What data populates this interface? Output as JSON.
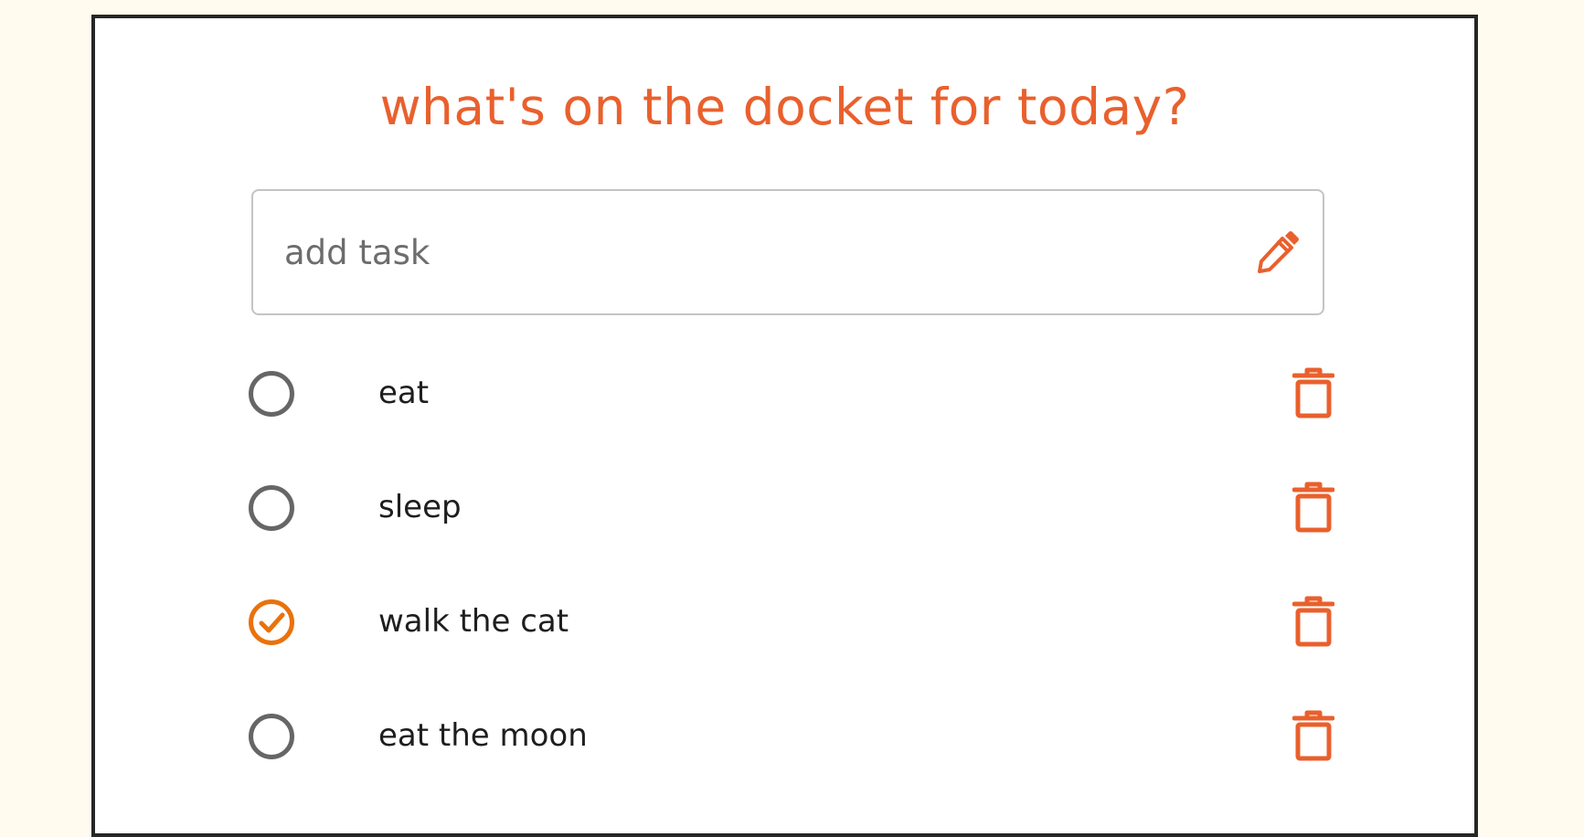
{
  "app": {
    "heading": "what's on the docket for today?"
  },
  "input": {
    "placeholder": "add task",
    "value": ""
  },
  "tasks": [
    {
      "label": "eat",
      "done": false
    },
    {
      "label": "sleep",
      "done": false
    },
    {
      "label": "walk the cat",
      "done": true
    },
    {
      "label": "eat the moon",
      "done": false
    }
  ],
  "icons": {
    "add": "pencil-icon",
    "delete": "trash-icon",
    "unchecked": "circle-icon",
    "checked": "circle-check-icon"
  },
  "colors": {
    "accent": "#e9602d",
    "checked": "#e9720c",
    "unchecked": "#666666",
    "background": "#fffcef",
    "card_border": "#262626",
    "text": "#1e1e1e"
  }
}
